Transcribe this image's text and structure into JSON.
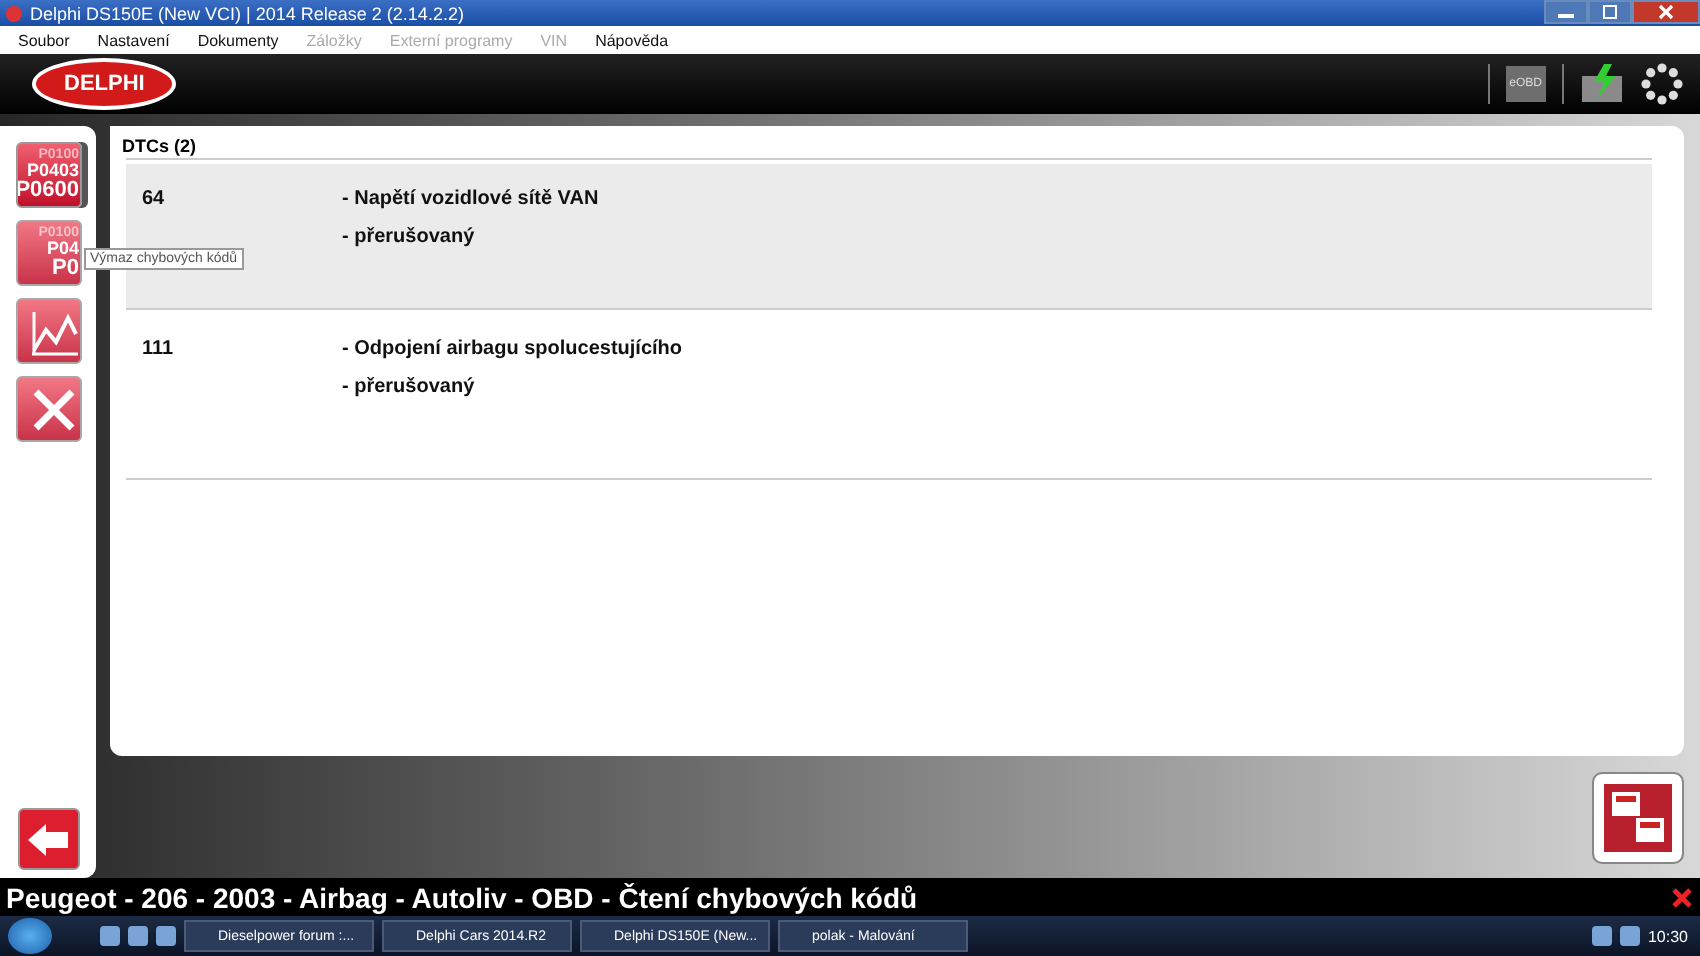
{
  "window": {
    "title": "Delphi DS150E (New VCI) | 2014 Release 2 (2.14.2.2)"
  },
  "menu": [
    {
      "label": "Soubor",
      "disabled": false
    },
    {
      "label": "Nastavení",
      "disabled": false
    },
    {
      "label": "Dokumenty",
      "disabled": false
    },
    {
      "label": "Záložky",
      "disabled": true
    },
    {
      "label": "Externí programy",
      "disabled": true
    },
    {
      "label": "VIN",
      "disabled": true
    },
    {
      "label": "Nápověda",
      "disabled": false
    }
  ],
  "header": {
    "logo": "DELPHI",
    "obd_badge": "eOBD"
  },
  "sidebar": [
    {
      "kind": "codes",
      "lines": [
        "P0100",
        "P0403",
        "P0600"
      ],
      "selected": true
    },
    {
      "kind": "codes",
      "lines": [
        "P0100",
        "P04",
        "P0"
      ],
      "selected": false
    },
    {
      "kind": "graph",
      "selected": false
    },
    {
      "kind": "tools",
      "selected": false
    }
  ],
  "tooltip": "Výmaz chybových kódů",
  "tab": {
    "label": "DTCs (2)"
  },
  "dtcs": [
    {
      "code": "64",
      "lines": [
        "- Napětí vozidlové sítě VAN",
        "- přerušovaný"
      ],
      "selected": true
    },
    {
      "code": "111",
      "lines": [
        "- Odpojení airbagu spolucestujícího",
        "- přerušovaný"
      ],
      "selected": false
    }
  ],
  "status_bar": {
    "text": "Peugeot - 206 - 2003 - Airbag - Autoliv - OBD - Čtení chybových kódů"
  },
  "taskbar": {
    "items": [
      "Dieselpower forum :...",
      "Delphi Cars 2014.R2",
      "Delphi DS150E (New...",
      "polak - Malování"
    ],
    "time": "10:30"
  }
}
